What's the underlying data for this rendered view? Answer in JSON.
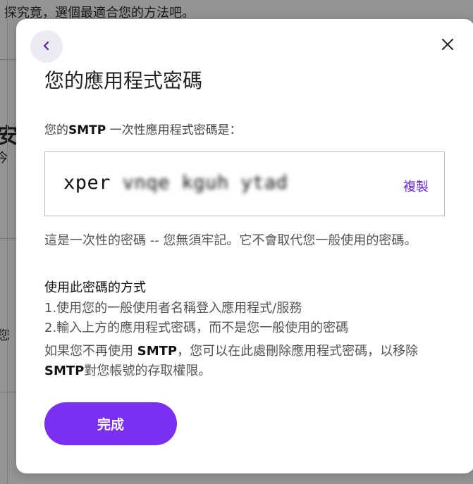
{
  "background": {
    "header_text": "探究竟，選個最適合您的方法吧。",
    "side_char_1": "安",
    "side_char_2": "今",
    "side_char_3": "您"
  },
  "modal": {
    "title": "您的應用程式密碼",
    "intro_prefix": "您的",
    "intro_bold": "SMTP",
    "intro_suffix": " 一次性應用程式密碼是：",
    "password": {
      "part1": "xper",
      "part2": "vnqe",
      "part3": "kguh",
      "part4": "ytad",
      "copy_label": "複製"
    },
    "note": "這是一次性的密碼 -- 您無須牢記。它不會取代您一般使用的密碼。",
    "howto_title": "使用此密碼的方式",
    "steps": [
      "1.使用您的一般使用者名稱登入應用程式/服務",
      "2.輸入上方的應用程式密碼，而不是您一般使用的密碼"
    ],
    "remove_note": {
      "t1": "如果您不再使用 ",
      "b1": "SMTP",
      "t2": "，您可以在此處刪除應用程式密碼，以移除 ",
      "b2": "SMTP",
      "t3": "對您帳號的存取權限。"
    },
    "done_label": "完成"
  },
  "colors": {
    "accent": "#7b2ff2",
    "link": "#6c2bd9",
    "back_button_bg": "#ebebf3"
  },
  "icons": {
    "back": "chevron-left-icon",
    "close": "close-icon"
  }
}
